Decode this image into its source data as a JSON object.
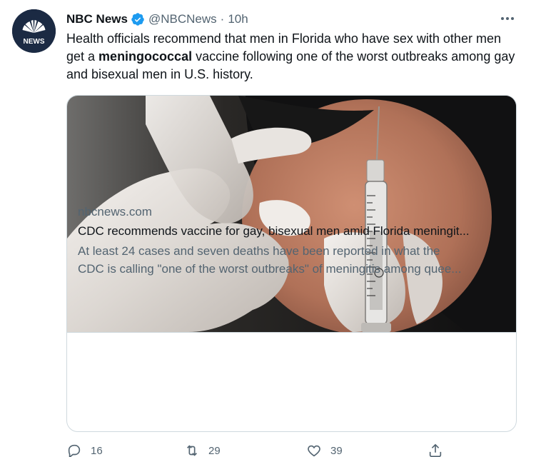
{
  "tweet": {
    "author": {
      "name": "NBC News",
      "handle": "@NBCNews",
      "avatar_text": "NEWS",
      "verified": true
    },
    "separator": "·",
    "time": "10h",
    "text": {
      "before": "Health officials recommend that men in Florida who have sex with other men get a ",
      "bold": "meningococcal",
      "after": " vaccine following one of the worst outbreaks among gay and bisexual men in U.S. history."
    },
    "card": {
      "domain": "nbcnews.com",
      "title": "CDC recommends vaccine for gay, bisexual men amid Florida meningit...",
      "description_line1": "At least 24 cases and seven deaths have been reported in what the",
      "description_line2": "CDC is calling \"one of the worst outbreaks\" of meningitis among quee..."
    },
    "actions": {
      "replies": "16",
      "retweets": "29",
      "likes": "39"
    }
  },
  "icons": {
    "verified": "verified-badge-icon",
    "more": "more-options-icon",
    "reply": "reply-icon",
    "retweet": "retweet-icon",
    "like": "like-icon",
    "share": "share-icon"
  },
  "colors": {
    "text_primary": "#0f1419",
    "text_secondary": "#536471",
    "border": "#cfd9de",
    "verified_blue": "#1d9bf0",
    "avatar_bg": "#1b2a43"
  }
}
